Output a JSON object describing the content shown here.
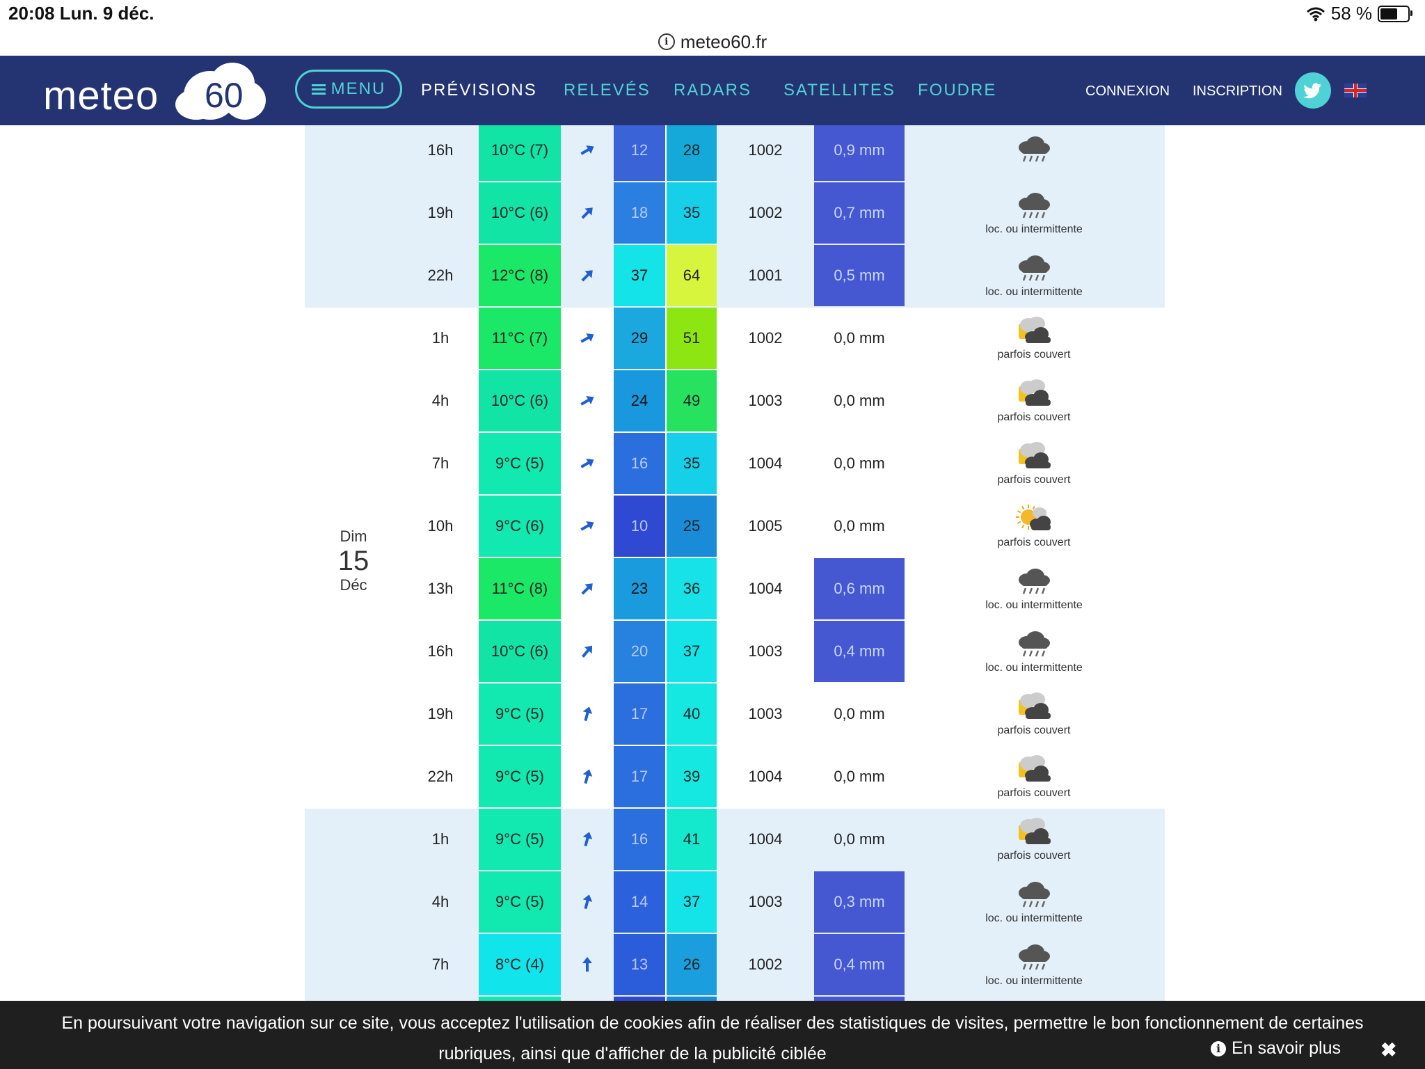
{
  "statusbar": {
    "time_date": "20:08   Lun. 9 déc.",
    "battery": "58 %",
    "battery_level": 0.58
  },
  "browser": {
    "url": "meteo60.fr"
  },
  "header": {
    "logo_text": "meteo",
    "logo_number": "60",
    "menu_label": "MENU",
    "nav": [
      "PRÉVISIONS",
      "RELEVÉS",
      "RADARS",
      "SATELLITES",
      "FOUDRE"
    ],
    "connexion": "CONNEXION",
    "inscription": "INSCRIPTION"
  },
  "forecast": {
    "days": [
      {
        "dow": "",
        "num": "",
        "mon": "",
        "rows": 3,
        "shade": "light"
      },
      {
        "dow": "Dim",
        "num": "15",
        "mon": "Déc",
        "rows": 8,
        "shade": "white"
      },
      {
        "dow": "",
        "num": "",
        "mon": "",
        "rows": 4,
        "shade": "light"
      }
    ],
    "rows": [
      {
        "hour": "16h",
        "temp": "10°C (7)",
        "temp_color": "#12e4a6",
        "wind_rot": 60,
        "avg": "12",
        "avg_color": "#3a63d8",
        "gust": "28",
        "gust_color": "#14a9d8",
        "press": "1002",
        "rain": "0,9 mm",
        "rain_color": "#4657d2",
        "sky": "",
        "icon": "rain",
        "shade": "light"
      },
      {
        "hour": "19h",
        "temp": "10°C (6)",
        "temp_color": "#12e4a6",
        "wind_rot": 45,
        "avg": "18",
        "avg_color": "#2b7fe0",
        "gust": "35",
        "gust_color": "#16cfe8",
        "press": "1002",
        "rain": "0,7 mm",
        "rain_color": "#4657d2",
        "sky": "loc. ou intermittente",
        "icon": "rain",
        "shade": "light"
      },
      {
        "hour": "22h",
        "temp": "12°C (8)",
        "temp_color": "#1be866",
        "wind_rot": 45,
        "avg": "37",
        "avg_color": "#14e3e8",
        "gust": "64",
        "gust_color": "#d6f53c",
        "press": "1001",
        "rain": "0,5 mm",
        "rain_color": "#4657d2",
        "sky": "loc. ou intermittente",
        "icon": "rain",
        "shade": "light"
      },
      {
        "hour": "1h",
        "temp": "11°C (7)",
        "temp_color": "#1be866",
        "wind_rot": 60,
        "avg": "29",
        "avg_color": "#1aa8de",
        "gust": "51",
        "gust_color": "#8de512",
        "press": "1002",
        "rain": "0,0 mm",
        "rain_color": "",
        "sky": "parfois couvert",
        "icon": "cloudsun",
        "shade": "white"
      },
      {
        "hour": "4h",
        "temp": "10°C (6)",
        "temp_color": "#12e4a6",
        "wind_rot": 60,
        "avg": "24",
        "avg_color": "#1a98de",
        "gust": "49",
        "gust_color": "#27e25f",
        "press": "1003",
        "rain": "0,0 mm",
        "rain_color": "",
        "sky": "parfois couvert",
        "icon": "cloudsun",
        "shade": "white"
      },
      {
        "hour": "7h",
        "temp": "9°C (5)",
        "temp_color": "#12e9b0",
        "wind_rot": 60,
        "avg": "16",
        "avg_color": "#2b6fdf",
        "gust": "35",
        "gust_color": "#16cfe8",
        "press": "1004",
        "rain": "0,0 mm",
        "rain_color": "",
        "sky": "parfois couvert",
        "icon": "cloudsun",
        "shade": "white"
      },
      {
        "hour": "10h",
        "temp": "9°C (6)",
        "temp_color": "#12e9b0",
        "wind_rot": 60,
        "avg": "10",
        "avg_color": "#2f49d2",
        "gust": "25",
        "gust_color": "#1a8bd9",
        "press": "1005",
        "rain": "0,0 mm",
        "rain_color": "",
        "sky": "parfois couvert",
        "icon": "sunny",
        "shade": "white"
      },
      {
        "hour": "13h",
        "temp": "11°C (8)",
        "temp_color": "#1be866",
        "wind_rot": 45,
        "avg": "23",
        "avg_color": "#1a9bde",
        "gust": "36",
        "gust_color": "#16e2e8",
        "press": "1004",
        "rain": "0,6 mm",
        "rain_color": "#4657d2",
        "sky": "loc. ou intermittente",
        "icon": "rain",
        "shade": "white"
      },
      {
        "hour": "16h",
        "temp": "10°C (6)",
        "temp_color": "#12e4a6",
        "wind_rot": 40,
        "avg": "20",
        "avg_color": "#2682de",
        "gust": "37",
        "gust_color": "#14e3e8",
        "press": "1003",
        "rain": "0,4 mm",
        "rain_color": "#4657d2",
        "sky": "loc. ou intermittente",
        "icon": "rain",
        "shade": "white"
      },
      {
        "hour": "19h",
        "temp": "9°C (5)",
        "temp_color": "#12e9b0",
        "wind_rot": 15,
        "avg": "17",
        "avg_color": "#2b6fdf",
        "gust": "40",
        "gust_color": "#14e8e0",
        "press": "1003",
        "rain": "0,0 mm",
        "rain_color": "",
        "sky": "parfois couvert",
        "icon": "cloudsun",
        "shade": "white"
      },
      {
        "hour": "22h",
        "temp": "9°C (5)",
        "temp_color": "#12e9b0",
        "wind_rot": 15,
        "avg": "17",
        "avg_color": "#2b6fdf",
        "gust": "39",
        "gust_color": "#14e8e0",
        "press": "1004",
        "rain": "0,0 mm",
        "rain_color": "",
        "sky": "parfois couvert",
        "icon": "cloudsun",
        "shade": "white"
      },
      {
        "hour": "1h",
        "temp": "9°C (5)",
        "temp_color": "#12e9b0",
        "wind_rot": 15,
        "avg": "16",
        "avg_color": "#2b6fdf",
        "gust": "41",
        "gust_color": "#14e8cd",
        "press": "1004",
        "rain": "0,0 mm",
        "rain_color": "",
        "sky": "parfois couvert",
        "icon": "cloudsun",
        "shade": "light"
      },
      {
        "hour": "4h",
        "temp": "9°C (5)",
        "temp_color": "#12e9b0",
        "wind_rot": 15,
        "avg": "14",
        "avg_color": "#2b62dc",
        "gust": "37",
        "gust_color": "#14e3e8",
        "press": "1003",
        "rain": "0,3 mm",
        "rain_color": "#4657d2",
        "sky": "loc. ou intermittente",
        "icon": "rain",
        "shade": "light"
      },
      {
        "hour": "7h",
        "temp": "8°C (4)",
        "temp_color": "#12e4ec",
        "wind_rot": 0,
        "avg": "13",
        "avg_color": "#2b5cda",
        "gust": "26",
        "gust_color": "#1a9ede",
        "press": "1002",
        "rain": "0,4 mm",
        "rain_color": "#4657d2",
        "sky": "loc. ou intermittente",
        "icon": "rain",
        "shade": "light"
      },
      {
        "hour": "",
        "temp": "",
        "temp_color": "#12e9b0",
        "wind_rot": 0,
        "avg": "",
        "avg_color": "#2f49d2",
        "gust": "",
        "gust_color": "#1a8bd9",
        "press": "",
        "rain": "",
        "rain_color": "#4657d2",
        "sky": "",
        "icon": "rain",
        "shade": "light"
      }
    ]
  },
  "cookie": {
    "line1": "En poursuivant votre navigation sur ce site, vous acceptez l'utilisation de cookies afin de réaliser des statistiques de visites, permettre le bon fonctionnement de certaines",
    "line2": "rubriques, ainsi que d'afficher de la publicité ciblée",
    "more": "En savoir plus",
    "close": "✖"
  }
}
